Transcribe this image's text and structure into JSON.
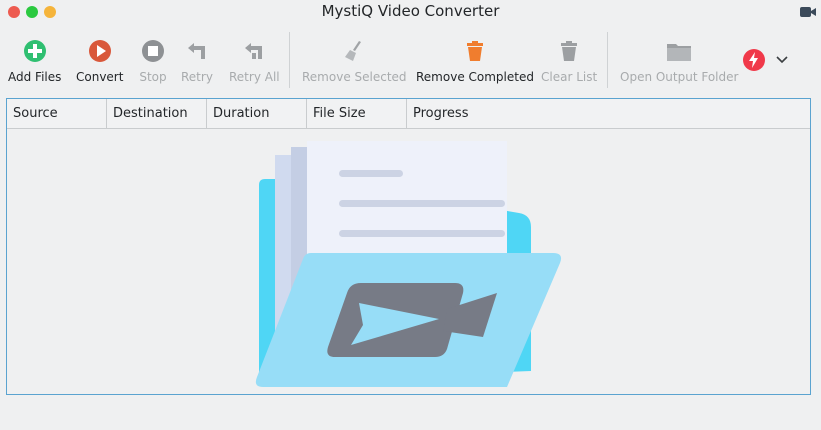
{
  "window": {
    "title": "MystiQ Video Converter",
    "title_icon": "video-camera-icon"
  },
  "toolbar": {
    "add_files": "Add Files",
    "convert": "Convert",
    "stop": "Stop",
    "retry": "Retry",
    "retry_all": "Retry All",
    "remove_selected": "Remove Selected",
    "remove_completed": "Remove Completed",
    "clear_list": "Clear List",
    "open_output_folder": "Open Output Folder",
    "more_icon": "lightning-icon"
  },
  "table": {
    "columns": [
      "Source",
      "Destination",
      "Duration",
      "File Size",
      "Progress"
    ],
    "rows": []
  },
  "colors": {
    "add": "#2fbf71",
    "convert": "#d9583b",
    "remove_completed": "#f07d2e",
    "lightning": "#f0394a",
    "table_border": "#5aa3d0"
  }
}
